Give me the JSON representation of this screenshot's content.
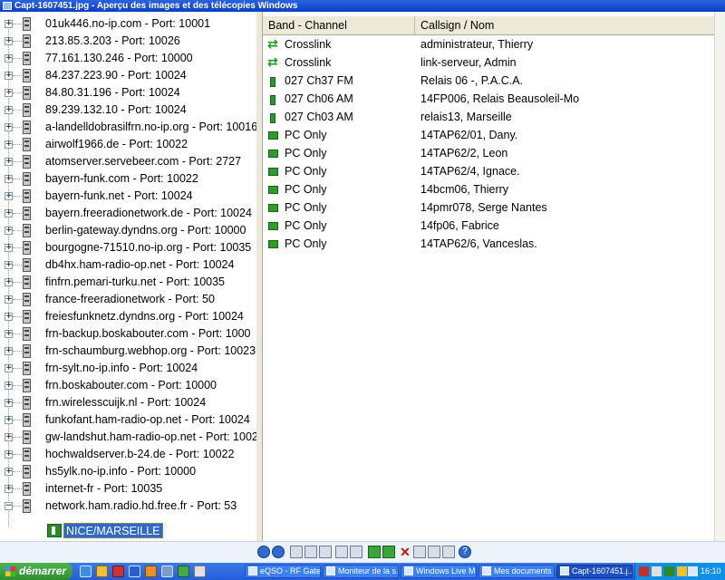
{
  "window": {
    "title": "Capt-1607451.jpg - Aperçu des images et des télécopies Windows"
  },
  "tree": {
    "servers": [
      "01uk446.no-ip.com - Port: 10001",
      "213.85.3.203 - Port: 10026",
      "77.161.130.246 - Port: 10000",
      "84.237.223.90 - Port: 10024",
      "84.80.31.196 - Port: 10024",
      "89.239.132.10 - Port: 10024",
      "a-landelldobrasilfrn.no-ip.org - Port: 10016",
      "airwolf1966.de - Port: 10022",
      "atomserver.servebeer.com - Port: 2727",
      "bayern-funk.com - Port: 10022",
      "bayern-funk.net - Port: 10024",
      "bayern.freeradionetwork.de - Port: 10024",
      "berlin-gateway.dyndns.org - Port: 10000",
      "bourgogne-71510.no-ip.org - Port: 10035",
      "db4hx.ham-radio-op.net - Port: 10024",
      "finfrn.pemari-turku.net - Port: 10035",
      "france-freeradionetwork - Port: 50",
      "freiesfunknetz.dyndns.org - Port: 10024",
      "frn-backup.boskabouter.com - Port: 1000",
      "frn-schaumburg.webhop.org - Port: 10023",
      "frn-sylt.no-ip.info - Port: 10024",
      "frn.boskabouter.com - Port: 10000",
      "frn.wirelesscuijk.nl - Port: 10024",
      "funkofant.ham-radio-op.net - Port: 10024",
      "gw-landshut.ham-radio-op.net - Port: 1002",
      "hochwaldserver.b-24.de - Port: 10022",
      "hs5ylk.no-ip.info - Port: 10000",
      "internet-fr - Port: 10035",
      "network.ham.radio.hd.free.fr - Port: 53"
    ],
    "selected_child": "NICE/MARSEILLE"
  },
  "list": {
    "columns": [
      "Band - Channel",
      "Callsign / Nom"
    ],
    "rows": [
      {
        "band": "Crosslink",
        "callsign": "administrateur, Thierry",
        "icon": "crosslink-icon"
      },
      {
        "band": "Crosslink",
        "callsign": "link-serveur, Admin",
        "icon": "crosslink-icon"
      },
      {
        "band": "027 Ch37 FM",
        "callsign": "Relais 06 -, P.A.C.A.",
        "icon": "relay-icon"
      },
      {
        "band": "027 Ch06 AM",
        "callsign": "14FP006, Relais Beausoleil-Mo",
        "icon": "relay-icon"
      },
      {
        "band": "027 Ch03 AM",
        "callsign": "relais13, Marseille",
        "icon": "relay-icon"
      },
      {
        "band": "PC Only",
        "callsign": "14TAP62/01, Dany.",
        "icon": "pc-icon"
      },
      {
        "band": "PC Only",
        "callsign": "14TAP62/2, Leon",
        "icon": "pc-icon"
      },
      {
        "band": "PC Only",
        "callsign": "14TAP62/4, Ignace.",
        "icon": "pc-icon"
      },
      {
        "band": "PC Only",
        "callsign": "14bcm06, Thierry",
        "icon": "pc-icon"
      },
      {
        "band": "PC Only",
        "callsign": "14pmr078, Serge Nantes",
        "icon": "pc-icon"
      },
      {
        "band": "PC Only",
        "callsign": "14fp06, Fabrice",
        "icon": "pc-icon"
      },
      {
        "band": "PC Only",
        "callsign": "14TAP62/6, Vanceslas.",
        "icon": "pc-icon"
      }
    ]
  },
  "taskbar": {
    "start_label": "démarrer",
    "tasks": [
      {
        "label": "eQSO - RF Gate ...",
        "active": false
      },
      {
        "label": "Moniteur de la s...",
        "active": false
      },
      {
        "label": "Windows Live M...",
        "active": false
      },
      {
        "label": "Mes documents",
        "active": false
      },
      {
        "label": "Capt-1607451.j...",
        "active": true
      }
    ],
    "clock": "16:10"
  },
  "colors": {
    "selection": "#316ac5",
    "titlebar": "#0a3fc4",
    "taskbar": "#245edb",
    "icon_green": "#2a9a2a"
  }
}
